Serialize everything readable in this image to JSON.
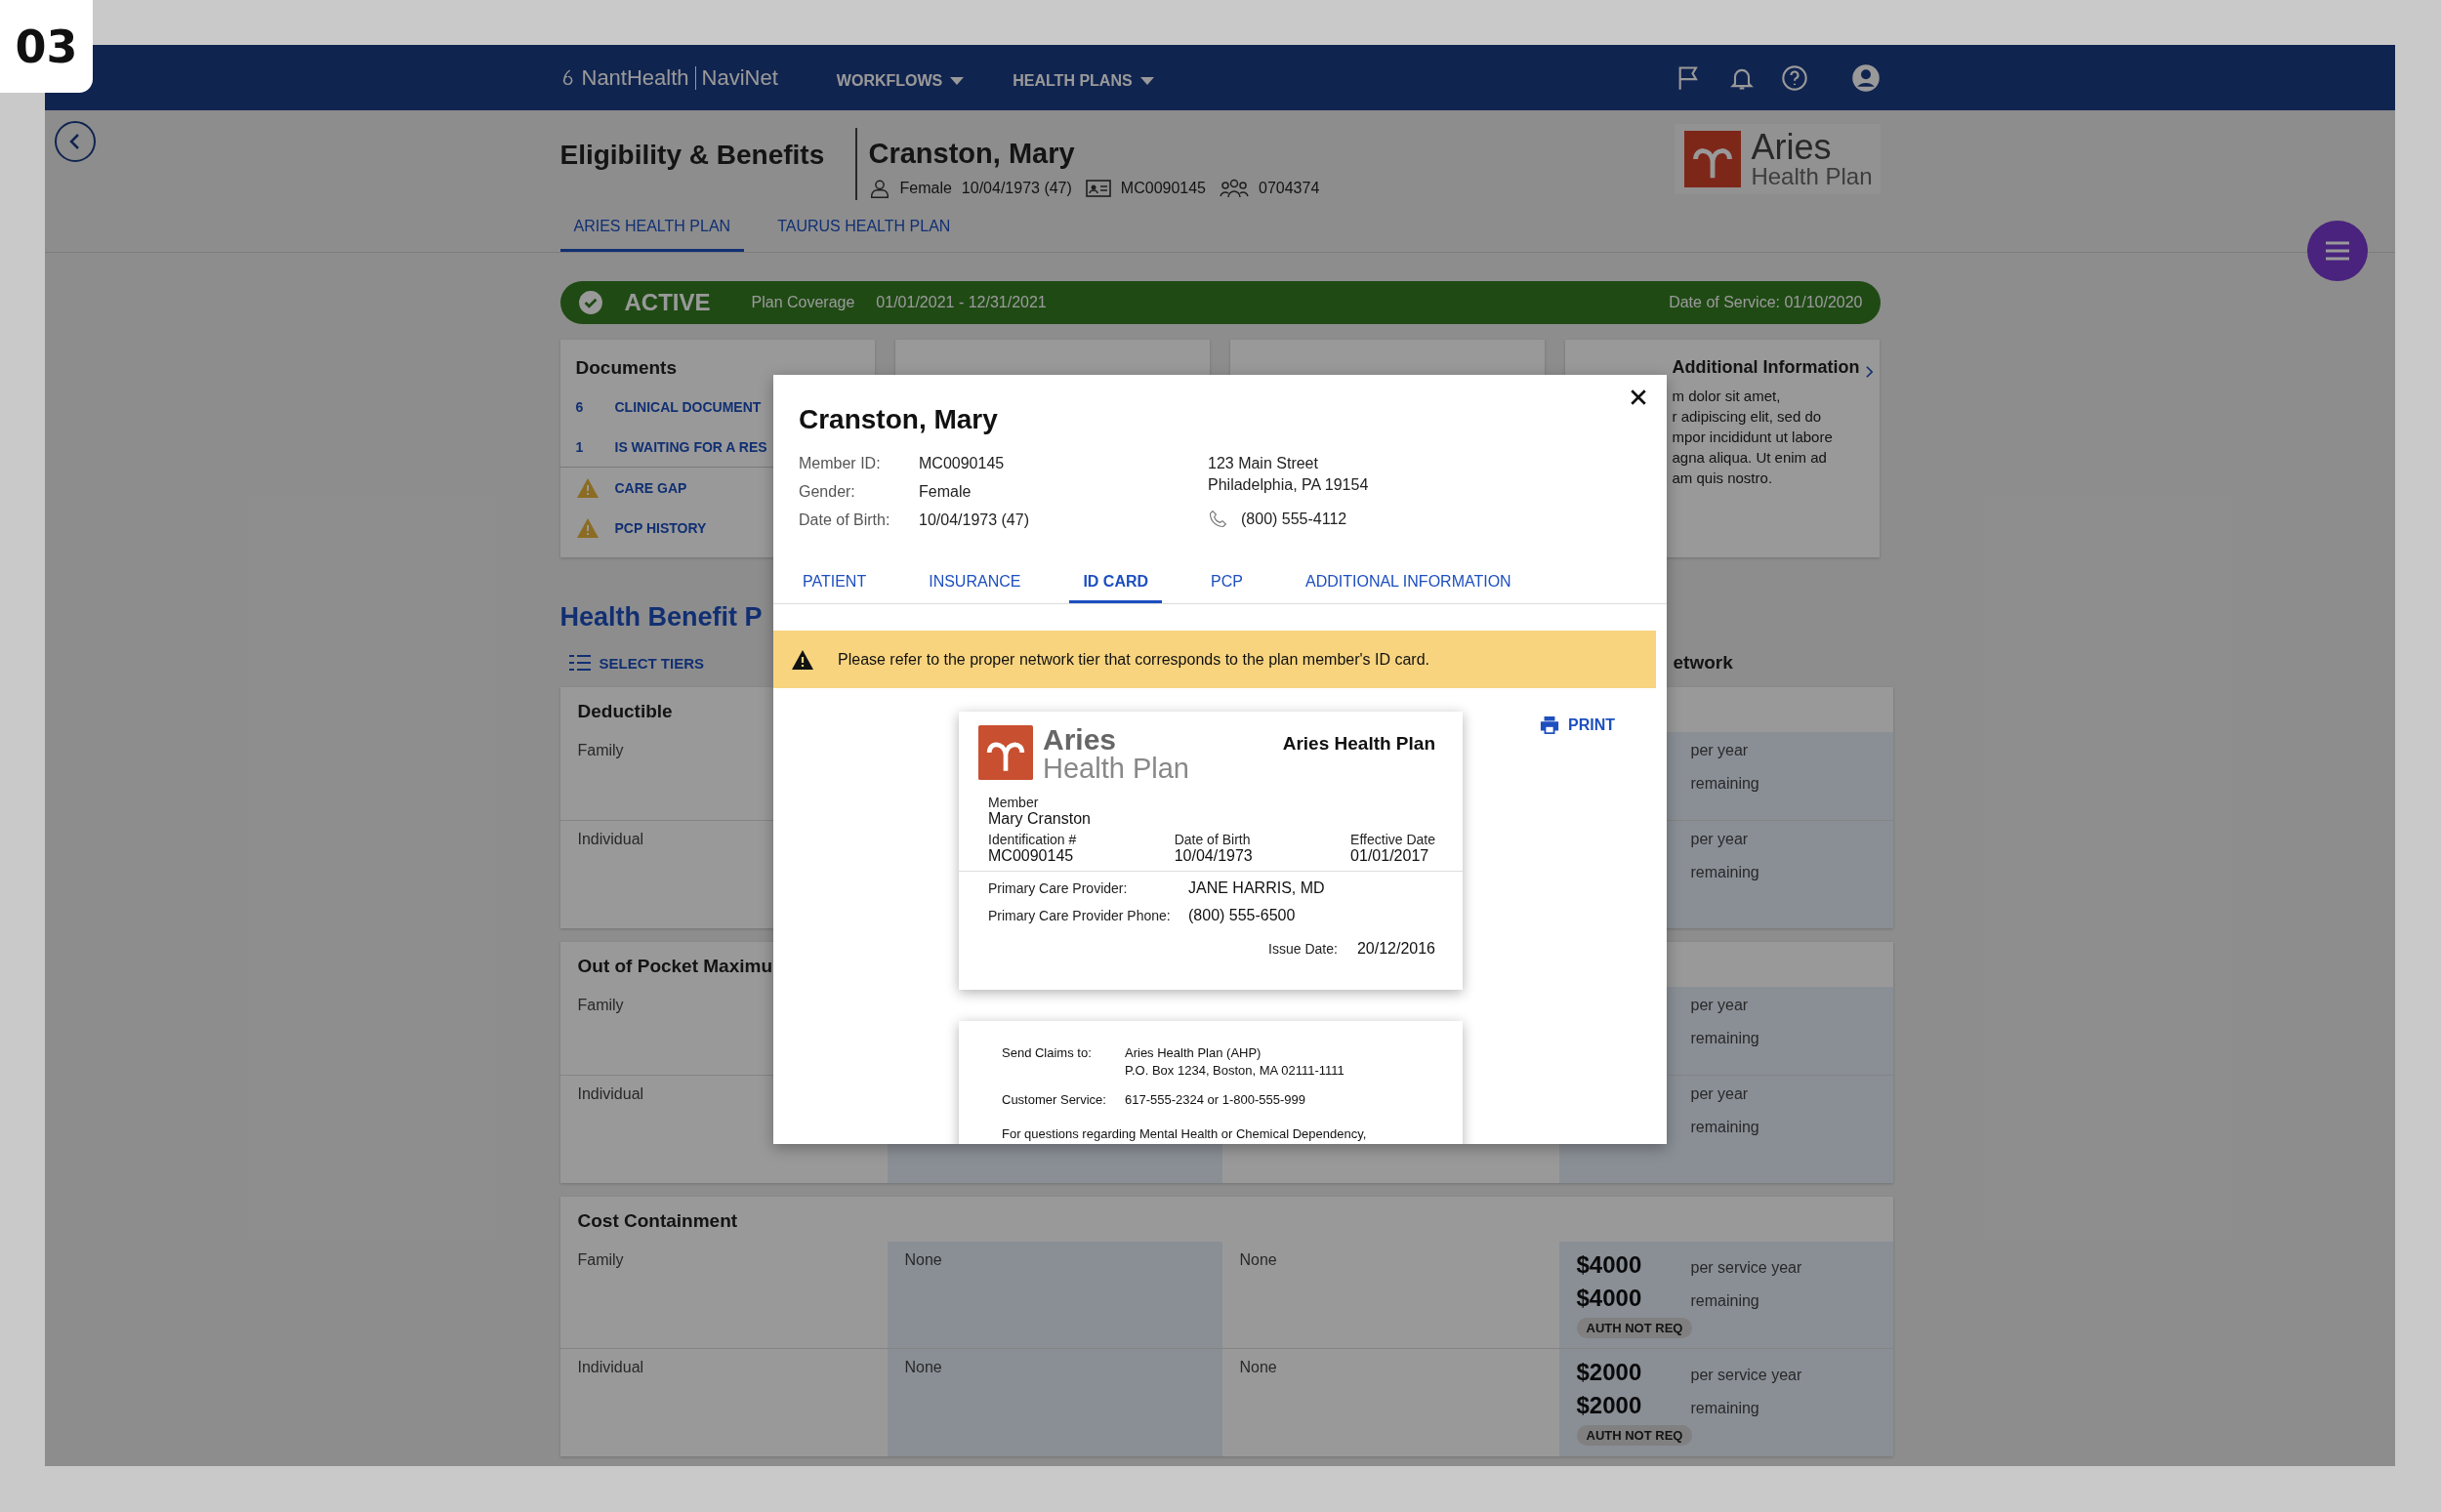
{
  "frame_label": "03",
  "header": {
    "brand": "NantHealth",
    "product": "NaviNet",
    "menus": [
      {
        "label": "WORKFLOWS"
      },
      {
        "label": "HEALTH PLANS"
      }
    ]
  },
  "page": {
    "title": "Eligibility & Benefits",
    "patient": {
      "name": "Cranston, Mary",
      "gender": "Female",
      "dob": "10/04/1973 (47)",
      "member_id": "MC0090145",
      "group": "0704374"
    },
    "plan_logo": {
      "name": "Aries",
      "subtitle": "Health Plan"
    }
  },
  "plan_tabs": [
    {
      "label": "ARIES HEALTH PLAN",
      "selected": true
    },
    {
      "label": "TAURUS HEALTH PLAN",
      "selected": false
    }
  ],
  "status_bar": {
    "status": "ACTIVE",
    "coverage_label": "Plan Coverage",
    "coverage": "01/01/2021 - 12/31/2021",
    "date_of_service": "Date of Service: 01/10/2020"
  },
  "documents": {
    "title": "Documents",
    "items": [
      {
        "kind": "count",
        "count": "6",
        "label": "CLINICAL DOCUMENT"
      },
      {
        "kind": "count",
        "count": "1",
        "label": "IS WAITING FOR A RES"
      },
      {
        "kind": "warning",
        "label": "CARE GAP"
      },
      {
        "kind": "warning",
        "label": "PCP HISTORY"
      }
    ]
  },
  "additional_info": {
    "title": "Additional Information",
    "lines": [
      "m dolor sit amet,",
      "r adipiscing elit, sed do",
      "mpor incididunt ut labore",
      "agna aliqua. Ut enim ad",
      "am quis nostro."
    ]
  },
  "benefits": {
    "title": "Health Benefit P",
    "select_tiers": "SELECT TIERS",
    "column_4_header": "etwork",
    "sections": [
      {
        "title": "Deductible",
        "rows": [
          {
            "label": "Family",
            "column_4": [
              {
                "note": "per year"
              },
              {
                "note": "remaining"
              }
            ]
          },
          {
            "label": "Individual",
            "column_4": [
              {
                "note": "per year"
              },
              {
                "note": "remaining"
              }
            ]
          }
        ]
      },
      {
        "title": "Out of Pocket Maximu",
        "rows": [
          {
            "label": "Family",
            "column_4": [
              {
                "note": "per year"
              },
              {
                "note": "remaining"
              }
            ]
          },
          {
            "label": "Individual",
            "column_4": [
              {
                "note": "per year"
              },
              {
                "note": "remaining"
              }
            ]
          }
        ]
      },
      {
        "title": "Cost Containment",
        "rows": [
          {
            "label": "Family",
            "column_2": "None",
            "column_3": "None",
            "column_4": [
              {
                "amount": "$4000",
                "note": "per service year"
              },
              {
                "amount": "$4000",
                "note": "remaining"
              }
            ],
            "badge": "AUTH NOT REQ"
          },
          {
            "label": "Individual",
            "column_2": "None",
            "column_3": "None",
            "column_4": [
              {
                "amount": "$2000",
                "note": "per service year"
              },
              {
                "amount": "$2000",
                "note": "remaining"
              }
            ],
            "badge": "AUTH NOT REQ"
          }
        ]
      }
    ]
  },
  "modal": {
    "name": "Cranston, Mary",
    "details": [
      {
        "label": "Member ID:",
        "value": "MC0090145"
      },
      {
        "label": "Gender:",
        "value": "Female"
      },
      {
        "label": "Date of Birth:",
        "value": "10/04/1973 (47)"
      }
    ],
    "address": [
      "123 Main Street",
      "Philadelphia, PA 19154"
    ],
    "phone": "(800) 555-4112",
    "tabs": [
      {
        "label": "PATIENT",
        "selected": false
      },
      {
        "label": "INSURANCE",
        "selected": false
      },
      {
        "label": "ID CARD",
        "selected": true
      },
      {
        "label": "PCP",
        "selected": false
      },
      {
        "label": "ADDITIONAL INFORMATION",
        "selected": false
      }
    ],
    "warning": "Please refer to the proper network tier that corresponds to the plan member's ID card.",
    "print": "PRINT",
    "id_card": {
      "logo_name": "Aries",
      "logo_subtitle": "Health Plan",
      "plan": "Aries Health Plan",
      "member_label": "Member",
      "member": "Mary Cranston",
      "columns": [
        {
          "label": "Identification #",
          "value": "MC0090145"
        },
        {
          "label": "Date of Birth",
          "value": "10/04/1973"
        },
        {
          "label": "Effective Date",
          "value": "01/01/2017"
        }
      ],
      "provider_rows": [
        {
          "label": "Primary Care Provider:",
          "value": "JANE HARRIS, MD"
        },
        {
          "label": "Primary Care Provider Phone:",
          "value": "(800) 555-6500"
        }
      ],
      "issue_label": "Issue Date:",
      "issue_date": "20/12/2016"
    },
    "card_back": {
      "rows": [
        {
          "label": "Send Claims to:",
          "lines": [
            "Aries Health Plan (AHP)",
            "P.O. Box 1234, Boston, MA 02111-1111"
          ]
        },
        {
          "label": "Customer Service:",
          "lines": [
            "617-555-2324 or 1-800-555-999"
          ]
        }
      ],
      "note": "For questions regarding Mental Health or Chemical Dependency,"
    }
  }
}
